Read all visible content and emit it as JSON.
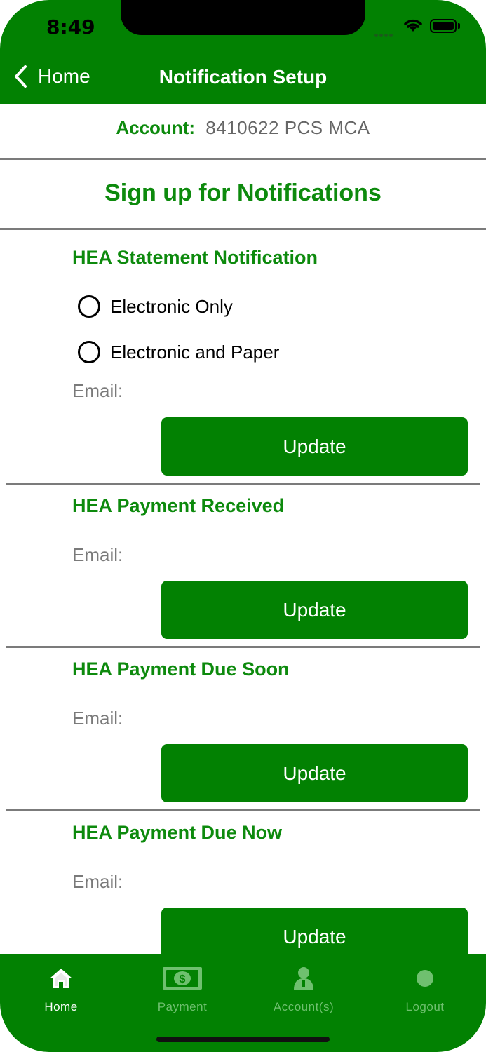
{
  "status_bar": {
    "time": "8:49"
  },
  "nav": {
    "back_label": "Home",
    "title": "Notification Setup"
  },
  "account": {
    "label": "Account:",
    "value": "8410622  PCS MCA"
  },
  "heading": "Sign up for Notifications",
  "sections": [
    {
      "title": "HEA Statement Notification",
      "options": [
        "Electronic Only",
        "Electronic and Paper"
      ],
      "email_label": "Email:",
      "button_label": "Update"
    },
    {
      "title": "HEA Payment Received",
      "email_label": "Email:",
      "button_label": "Update"
    },
    {
      "title": "HEA Payment Due Soon",
      "email_label": "Email:",
      "button_label": "Update"
    },
    {
      "title": "HEA Payment Due Now",
      "email_label": "Email:",
      "button_label": "Update"
    }
  ],
  "tabbar": {
    "items": [
      {
        "label": "Home",
        "icon": "home-icon",
        "active": true
      },
      {
        "label": "Payment",
        "icon": "money-icon",
        "active": false
      },
      {
        "label": "Account(s)",
        "icon": "account-icon",
        "active": false
      },
      {
        "label": "Logout",
        "icon": "logout-icon",
        "active": false
      }
    ]
  },
  "colors": {
    "primary": "#028102",
    "title_green": "#0d8a0d",
    "inactive_tab": "#6fc06f"
  }
}
